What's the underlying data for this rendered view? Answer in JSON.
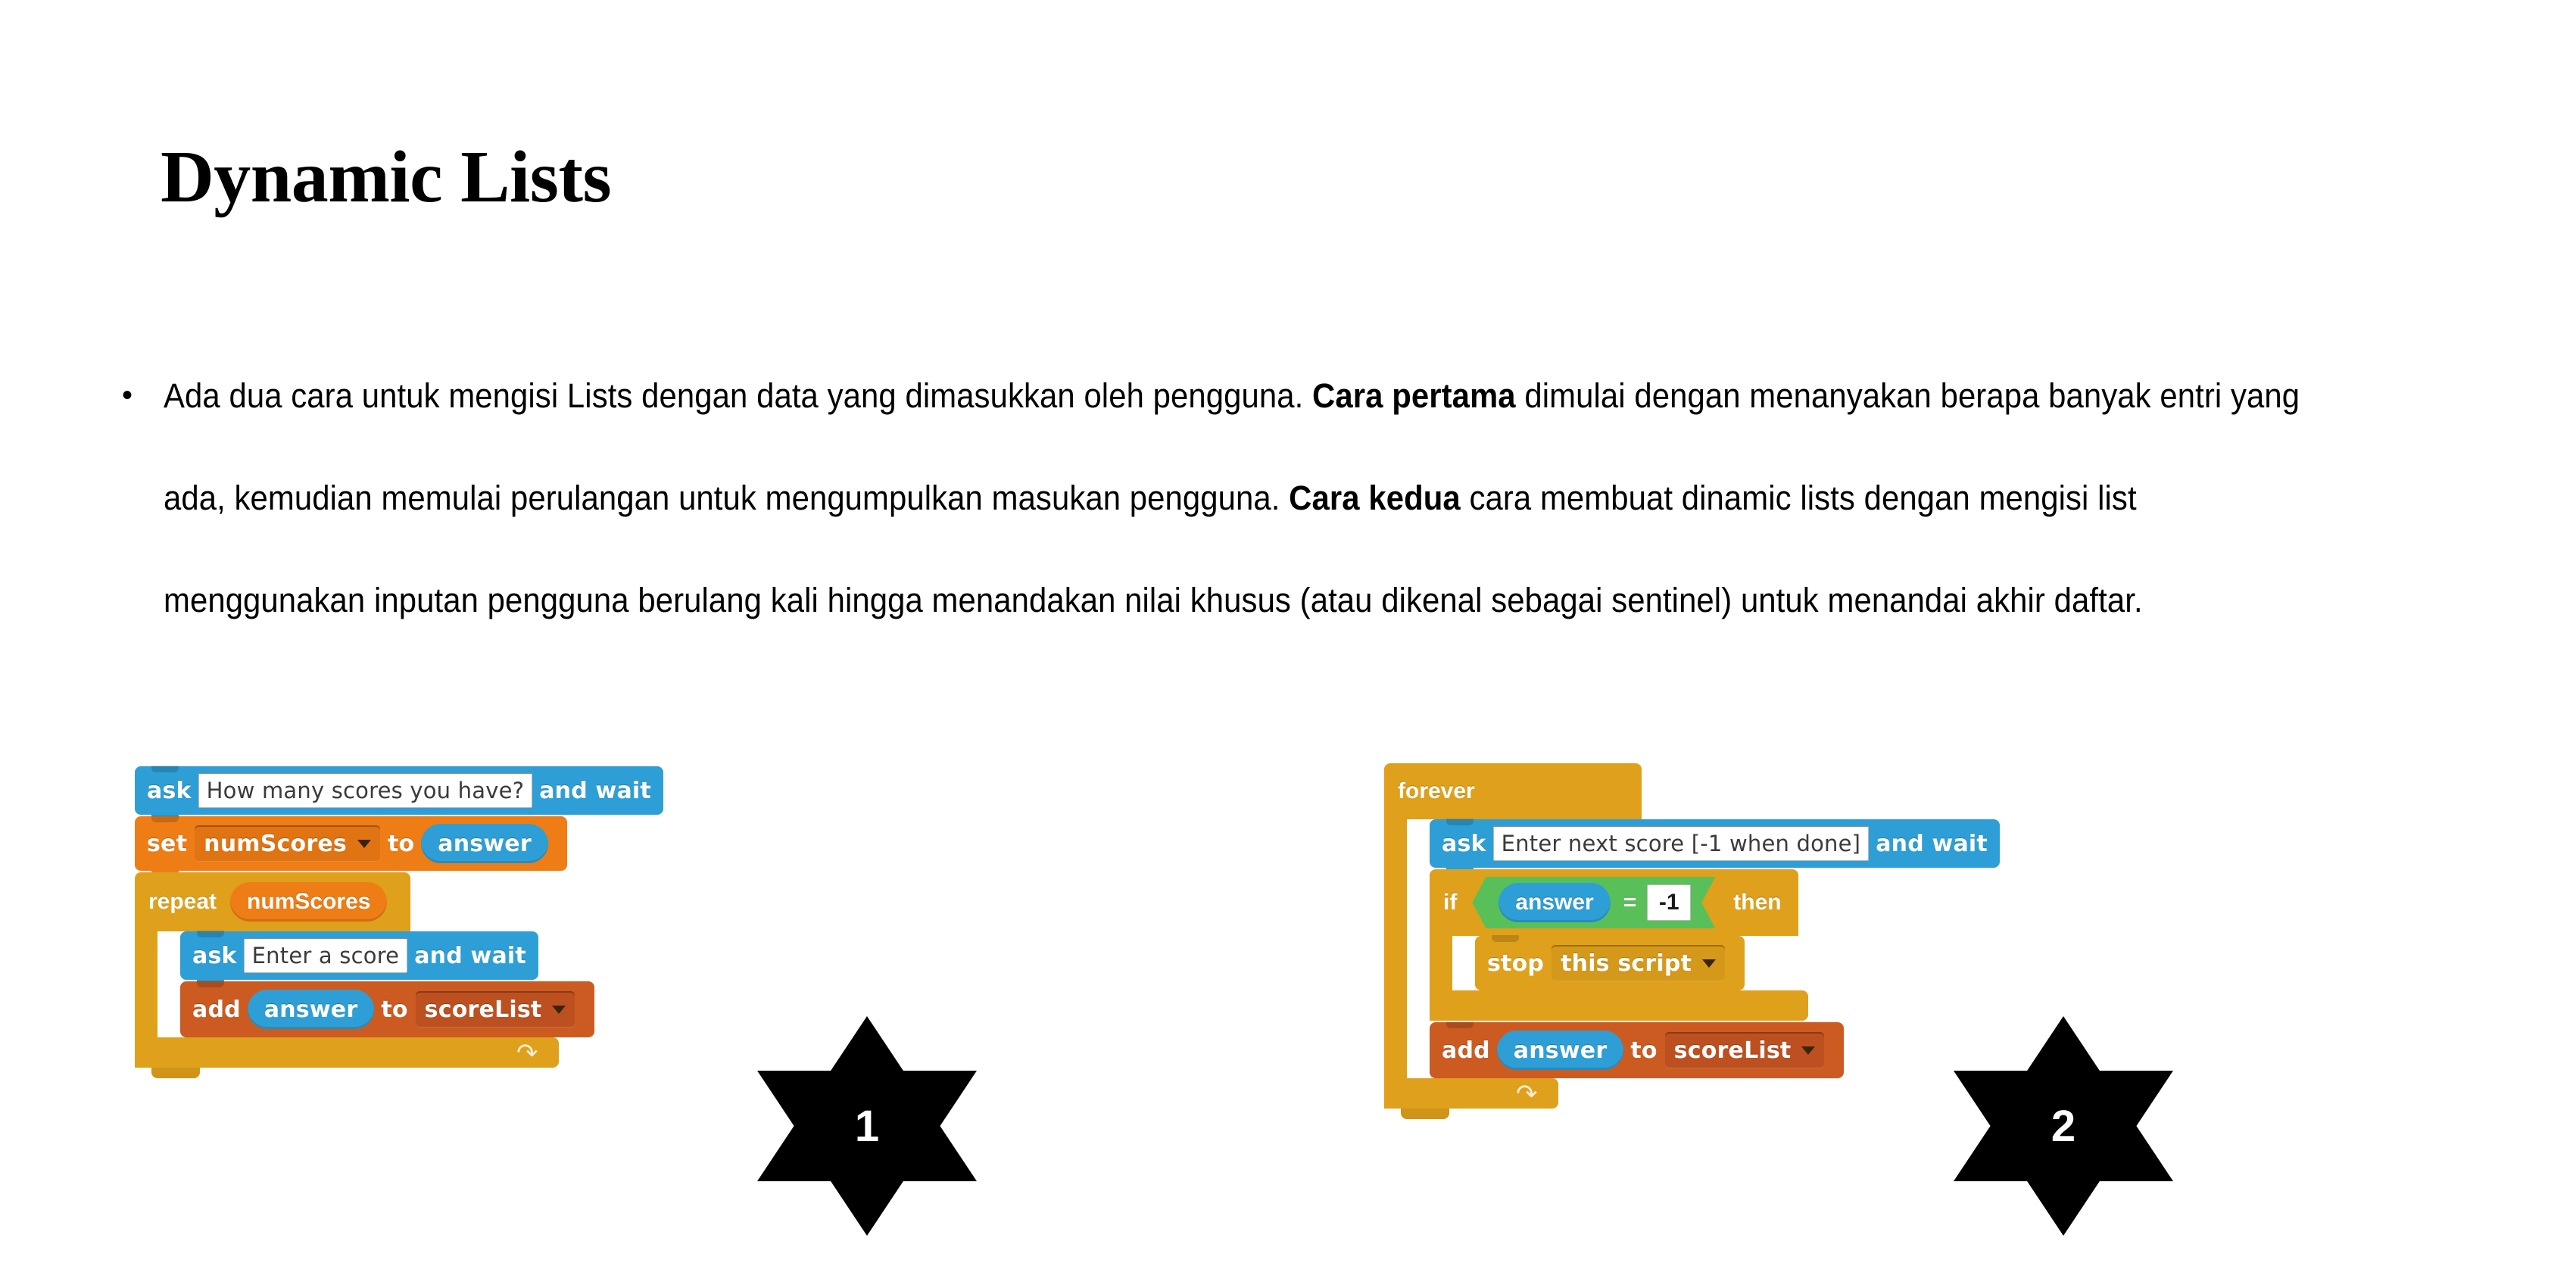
{
  "slide": {
    "title": "Dynamic Lists",
    "bullet_marker": "•",
    "paragraph_part_1": "Ada dua cara untuk mengisi Lists dengan data yang dimasukkan oleh pengguna. ",
    "paragraph_bold_1": "Cara pertama",
    "paragraph_part_2": " dimulai dengan menanyakan berapa banyak entri yang ada, kemudian memulai perulangan untuk mengumpulkan masukan pengguna. ",
    "paragraph_bold_2": "Cara kedua",
    "paragraph_part_3": " cara membuat dinamic lists dengan mengisi list menggunakan inputan pengguna berulang kali hingga menandakan nilai khusus (atau dikenal sebagai sentinel) untuk menandai akhir daftar."
  },
  "script_one": {
    "badge_number": "1",
    "ask_label": "ask",
    "ask_question": "How many scores you have?",
    "and_wait": "and  wait",
    "set_label": "set",
    "set_variable": "numScores",
    "to_label": "to",
    "answer_reporter": "answer",
    "repeat_label": "repeat",
    "repeat_times": "numScores",
    "inner_ask_label": "ask",
    "inner_ask_question": "Enter a score",
    "inner_and_wait": "and  wait",
    "add_label": "add",
    "add_value": "answer",
    "add_to_label": "to",
    "add_list": "scoreList"
  },
  "script_two": {
    "badge_number": "2",
    "forever_label": "forever",
    "ask_label": "ask",
    "ask_question": "Enter next score [-1 when done]",
    "and_wait": "and  wait",
    "if_label": "if",
    "if_left": "answer",
    "if_operator": "=",
    "if_right": "-1",
    "then_label": "then",
    "stop_label": "stop",
    "stop_option": "this script",
    "add_label": "add",
    "add_value": "answer",
    "add_to_label": "to",
    "add_list": "scoreList"
  },
  "colors": {
    "sensing_blue": "#2e9fd6",
    "data_orange": "#ee7d16",
    "list_orange": "#cc5b22",
    "control_yellow": "#dfa01b",
    "operator_green": "#59c059",
    "badge_black": "#000000",
    "text_black": "#000000",
    "background": "#ffffff"
  }
}
